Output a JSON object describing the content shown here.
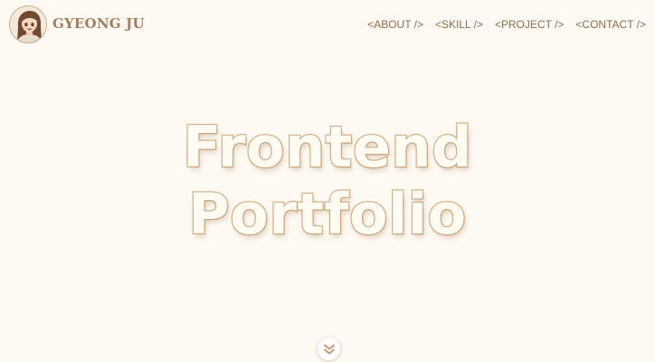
{
  "header": {
    "brand_name": "GYEONG JU",
    "avatar_icon": "avatar-illustration",
    "nav": [
      {
        "label": "<ABOUT />"
      },
      {
        "label": "<SKILL />"
      },
      {
        "label": "<PROJECT />"
      },
      {
        "label": "<CONTACT />"
      }
    ]
  },
  "hero": {
    "line1": "Frontend",
    "line2": "Portfolio"
  },
  "scroll_button": {
    "icon": "double-chevron-down-icon"
  },
  "colors": {
    "background": "#fefaf3",
    "accent": "#d9b48d",
    "text_brown": "#8f6b4f"
  }
}
